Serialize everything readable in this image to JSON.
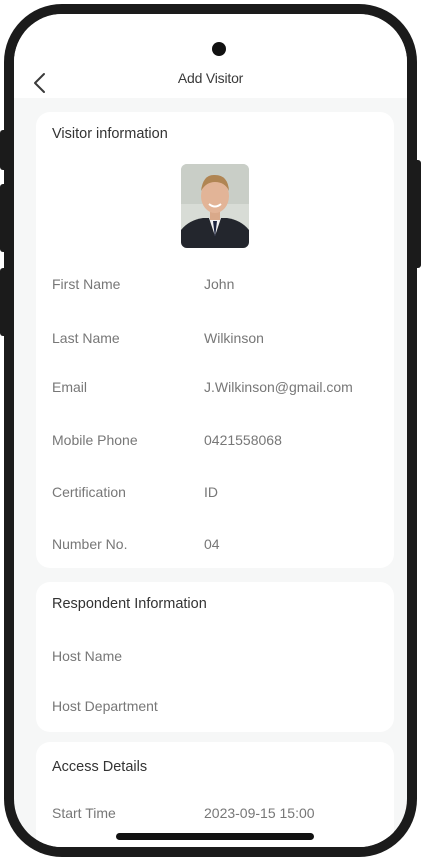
{
  "header": {
    "title": "Add Visitor"
  },
  "visitor": {
    "section_title": "Visitor information",
    "fields": [
      {
        "label": "First Name",
        "value": "John"
      },
      {
        "label": "Last Name",
        "value": "Wilkinson"
      },
      {
        "label": "Email",
        "value": "J.Wilkinson@gmail.com"
      },
      {
        "label": "Mobile Phone",
        "value": "0421558068"
      },
      {
        "label": "Certification",
        "value": "ID"
      },
      {
        "label": "Number No.",
        "value": "04"
      }
    ]
  },
  "respondent": {
    "section_title": "Respondent Information",
    "fields": [
      {
        "label": "Host Name",
        "value": ""
      },
      {
        "label": "Host Department",
        "value": ""
      }
    ]
  },
  "access": {
    "section_title": "Access Details",
    "fields": [
      {
        "label": "Start Time",
        "value": "2023-09-15 15:00"
      }
    ]
  },
  "icons": {
    "back": "chevron-left-icon",
    "camera": "front-camera-dot"
  }
}
